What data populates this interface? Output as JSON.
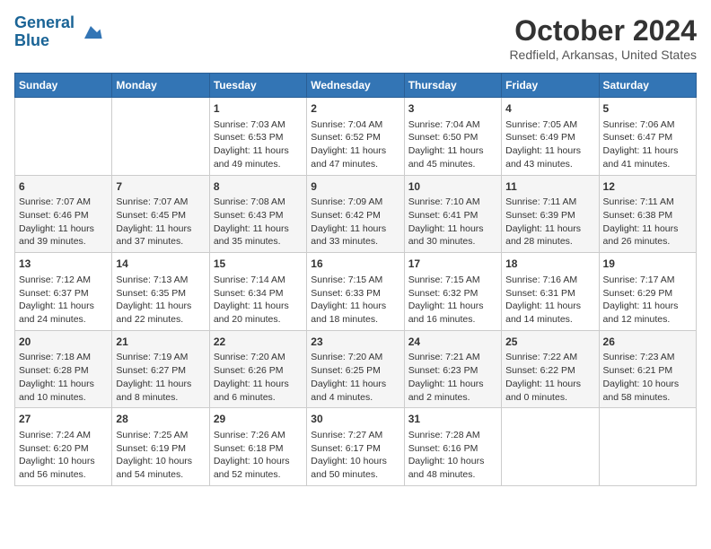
{
  "header": {
    "logo_line1": "General",
    "logo_line2": "Blue",
    "title": "October 2024",
    "subtitle": "Redfield, Arkansas, United States"
  },
  "weekdays": [
    "Sunday",
    "Monday",
    "Tuesday",
    "Wednesday",
    "Thursday",
    "Friday",
    "Saturday"
  ],
  "weeks": [
    [
      {
        "day": "",
        "detail": ""
      },
      {
        "day": "",
        "detail": ""
      },
      {
        "day": "1",
        "detail": "Sunrise: 7:03 AM\nSunset: 6:53 PM\nDaylight: 11 hours and 49 minutes."
      },
      {
        "day": "2",
        "detail": "Sunrise: 7:04 AM\nSunset: 6:52 PM\nDaylight: 11 hours and 47 minutes."
      },
      {
        "day": "3",
        "detail": "Sunrise: 7:04 AM\nSunset: 6:50 PM\nDaylight: 11 hours and 45 minutes."
      },
      {
        "day": "4",
        "detail": "Sunrise: 7:05 AM\nSunset: 6:49 PM\nDaylight: 11 hours and 43 minutes."
      },
      {
        "day": "5",
        "detail": "Sunrise: 7:06 AM\nSunset: 6:47 PM\nDaylight: 11 hours and 41 minutes."
      }
    ],
    [
      {
        "day": "6",
        "detail": "Sunrise: 7:07 AM\nSunset: 6:46 PM\nDaylight: 11 hours and 39 minutes."
      },
      {
        "day": "7",
        "detail": "Sunrise: 7:07 AM\nSunset: 6:45 PM\nDaylight: 11 hours and 37 minutes."
      },
      {
        "day": "8",
        "detail": "Sunrise: 7:08 AM\nSunset: 6:43 PM\nDaylight: 11 hours and 35 minutes."
      },
      {
        "day": "9",
        "detail": "Sunrise: 7:09 AM\nSunset: 6:42 PM\nDaylight: 11 hours and 33 minutes."
      },
      {
        "day": "10",
        "detail": "Sunrise: 7:10 AM\nSunset: 6:41 PM\nDaylight: 11 hours and 30 minutes."
      },
      {
        "day": "11",
        "detail": "Sunrise: 7:11 AM\nSunset: 6:39 PM\nDaylight: 11 hours and 28 minutes."
      },
      {
        "day": "12",
        "detail": "Sunrise: 7:11 AM\nSunset: 6:38 PM\nDaylight: 11 hours and 26 minutes."
      }
    ],
    [
      {
        "day": "13",
        "detail": "Sunrise: 7:12 AM\nSunset: 6:37 PM\nDaylight: 11 hours and 24 minutes."
      },
      {
        "day": "14",
        "detail": "Sunrise: 7:13 AM\nSunset: 6:35 PM\nDaylight: 11 hours and 22 minutes."
      },
      {
        "day": "15",
        "detail": "Sunrise: 7:14 AM\nSunset: 6:34 PM\nDaylight: 11 hours and 20 minutes."
      },
      {
        "day": "16",
        "detail": "Sunrise: 7:15 AM\nSunset: 6:33 PM\nDaylight: 11 hours and 18 minutes."
      },
      {
        "day": "17",
        "detail": "Sunrise: 7:15 AM\nSunset: 6:32 PM\nDaylight: 11 hours and 16 minutes."
      },
      {
        "day": "18",
        "detail": "Sunrise: 7:16 AM\nSunset: 6:31 PM\nDaylight: 11 hours and 14 minutes."
      },
      {
        "day": "19",
        "detail": "Sunrise: 7:17 AM\nSunset: 6:29 PM\nDaylight: 11 hours and 12 minutes."
      }
    ],
    [
      {
        "day": "20",
        "detail": "Sunrise: 7:18 AM\nSunset: 6:28 PM\nDaylight: 11 hours and 10 minutes."
      },
      {
        "day": "21",
        "detail": "Sunrise: 7:19 AM\nSunset: 6:27 PM\nDaylight: 11 hours and 8 minutes."
      },
      {
        "day": "22",
        "detail": "Sunrise: 7:20 AM\nSunset: 6:26 PM\nDaylight: 11 hours and 6 minutes."
      },
      {
        "day": "23",
        "detail": "Sunrise: 7:20 AM\nSunset: 6:25 PM\nDaylight: 11 hours and 4 minutes."
      },
      {
        "day": "24",
        "detail": "Sunrise: 7:21 AM\nSunset: 6:23 PM\nDaylight: 11 hours and 2 minutes."
      },
      {
        "day": "25",
        "detail": "Sunrise: 7:22 AM\nSunset: 6:22 PM\nDaylight: 11 hours and 0 minutes."
      },
      {
        "day": "26",
        "detail": "Sunrise: 7:23 AM\nSunset: 6:21 PM\nDaylight: 10 hours and 58 minutes."
      }
    ],
    [
      {
        "day": "27",
        "detail": "Sunrise: 7:24 AM\nSunset: 6:20 PM\nDaylight: 10 hours and 56 minutes."
      },
      {
        "day": "28",
        "detail": "Sunrise: 7:25 AM\nSunset: 6:19 PM\nDaylight: 10 hours and 54 minutes."
      },
      {
        "day": "29",
        "detail": "Sunrise: 7:26 AM\nSunset: 6:18 PM\nDaylight: 10 hours and 52 minutes."
      },
      {
        "day": "30",
        "detail": "Sunrise: 7:27 AM\nSunset: 6:17 PM\nDaylight: 10 hours and 50 minutes."
      },
      {
        "day": "31",
        "detail": "Sunrise: 7:28 AM\nSunset: 6:16 PM\nDaylight: 10 hours and 48 minutes."
      },
      {
        "day": "",
        "detail": ""
      },
      {
        "day": "",
        "detail": ""
      }
    ]
  ]
}
